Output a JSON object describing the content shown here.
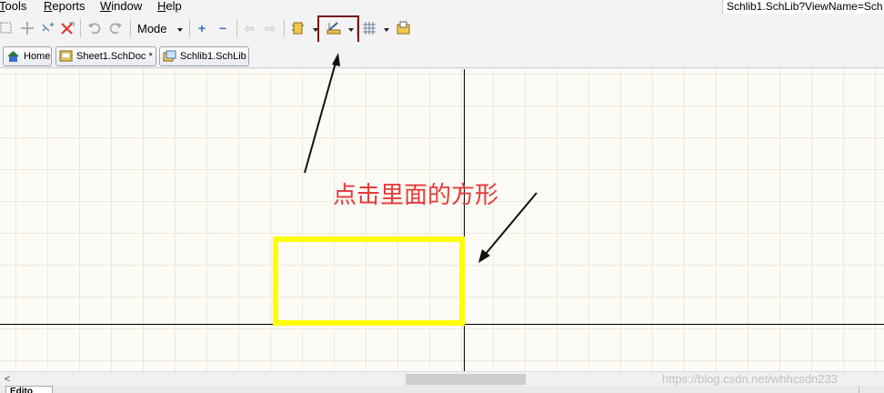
{
  "menu": {
    "items": [
      {
        "first": "T",
        "rest": "ools"
      },
      {
        "first": "R",
        "rest": "eports"
      },
      {
        "first": "W",
        "rest": "indow"
      },
      {
        "first": "H",
        "rest": "elp"
      }
    ],
    "url_text": "Schlib1.SchLib?ViewName=Sch"
  },
  "toolbar": {
    "mode_label": "Mode",
    "icons": [
      "select-area-icon",
      "move-icon",
      "cross-probe-icon",
      "clear-icon",
      "undo-icon",
      "redo-icon",
      "zoom-in-icon",
      "zoom-out-icon",
      "prev-icon",
      "next-icon",
      "component-icon",
      "place-tool-icon",
      "grid-icon",
      "library-icon"
    ]
  },
  "tabs": [
    {
      "label": "Home"
    },
    {
      "label": "Sheet1.SchDoc *"
    },
    {
      "label": "Schlib1.SchLib"
    }
  ],
  "canvas": {
    "annotation": "点击里面的方形",
    "annotation_color": "#e63a3a",
    "rect_color": "#ffff00",
    "box_color": "#7a1010"
  },
  "scrollbar": {
    "left_arrow": "<",
    "watermark": "https://blog.csdn.net/whhcsdn233"
  },
  "bottom": {
    "tab_label": "Edito"
  }
}
